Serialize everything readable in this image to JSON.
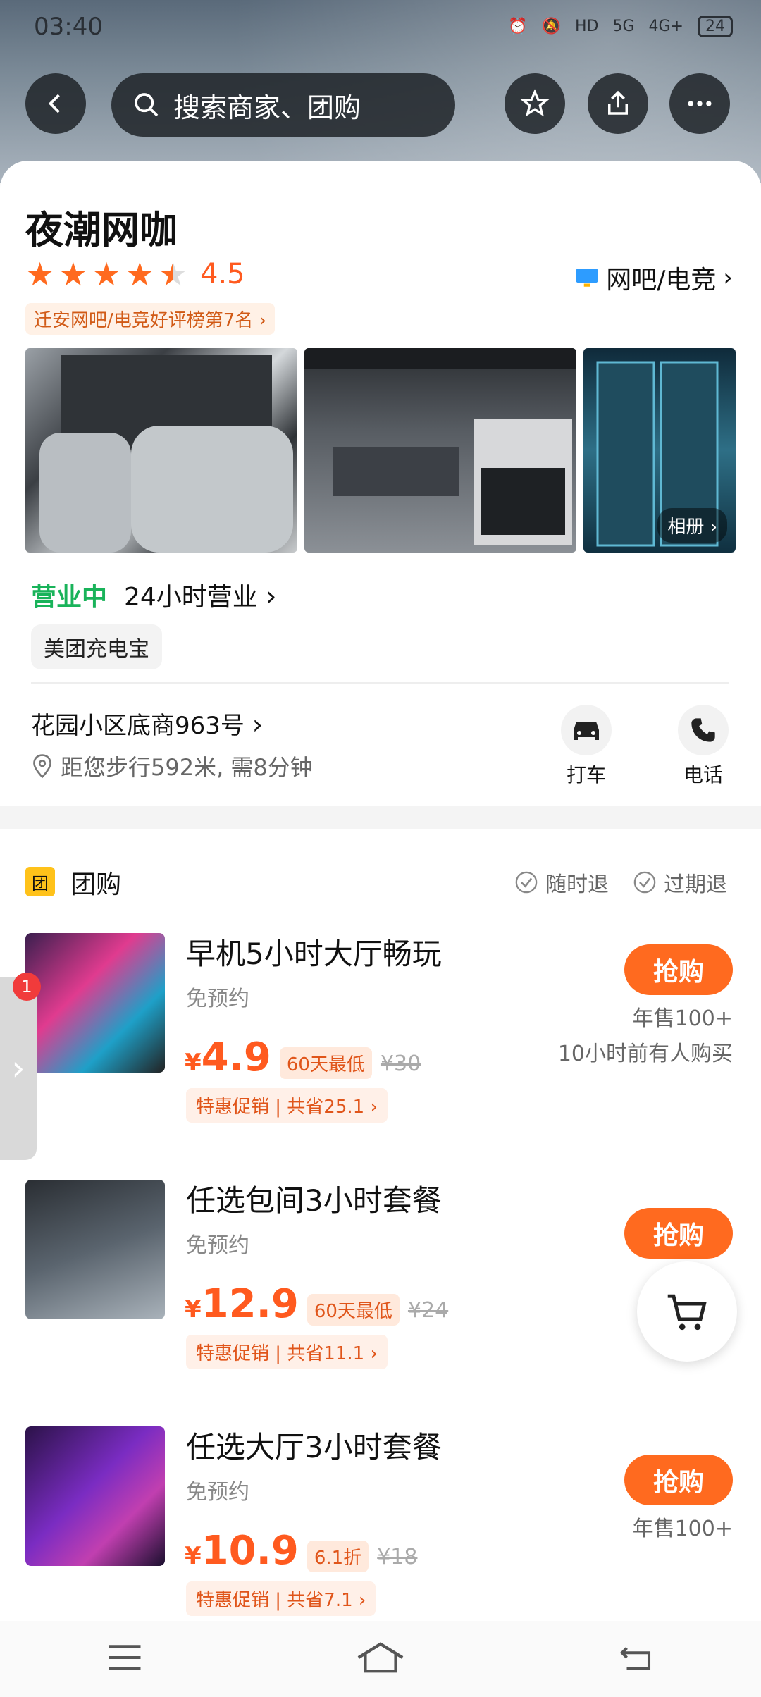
{
  "status": {
    "time": "03:40",
    "battery": "24",
    "net1": "HD",
    "net2": "5G",
    "net3": "4G+"
  },
  "search": {
    "placeholder": "搜索商家、团购"
  },
  "shop": {
    "name": "夜潮网咖",
    "rating": "4.5",
    "category": "网吧/电竞",
    "rank": "迁安网吧/电竞好评榜第7名",
    "album_label": "相册",
    "status": "营业中",
    "hours": "24小时营业",
    "tag": "美团充电宝",
    "address": "花园小区底商963号",
    "walk": "距您步行592米, 需8分钟",
    "actions": [
      {
        "label": "打车",
        "icon": "car-icon"
      },
      {
        "label": "电话",
        "icon": "phone-icon"
      }
    ]
  },
  "group": {
    "badge": "团",
    "title": "团购",
    "policy1": "随时退",
    "policy2": "过期退",
    "deals": [
      {
        "title": "早机5小时大厅畅玩",
        "sub": "免预约",
        "currency": "¥",
        "price": "4.9",
        "low": "60天最低",
        "orig": "¥30",
        "promo": "特惠促销 | 共省25.1",
        "buy": "抢购",
        "sales": "年售100+",
        "recent": "10小时前有人购买"
      },
      {
        "title": "任选包间3小时套餐",
        "sub": "免预约",
        "currency": "¥",
        "price": "12.9",
        "low": "60天最低",
        "orig": "¥24",
        "promo": "特惠促销 | 共省11.1",
        "buy": "抢购",
        "sales": "",
        "recent": ""
      },
      {
        "title": "任选大厅3小时套餐",
        "sub": "免预约",
        "currency": "¥",
        "price": "10.9",
        "low": "6.1折",
        "orig": "¥18",
        "promo": "特惠促销 | 共省7.1",
        "buy": "抢购",
        "sales": "年售100+",
        "recent": ""
      }
    ]
  },
  "side_badge": "1"
}
